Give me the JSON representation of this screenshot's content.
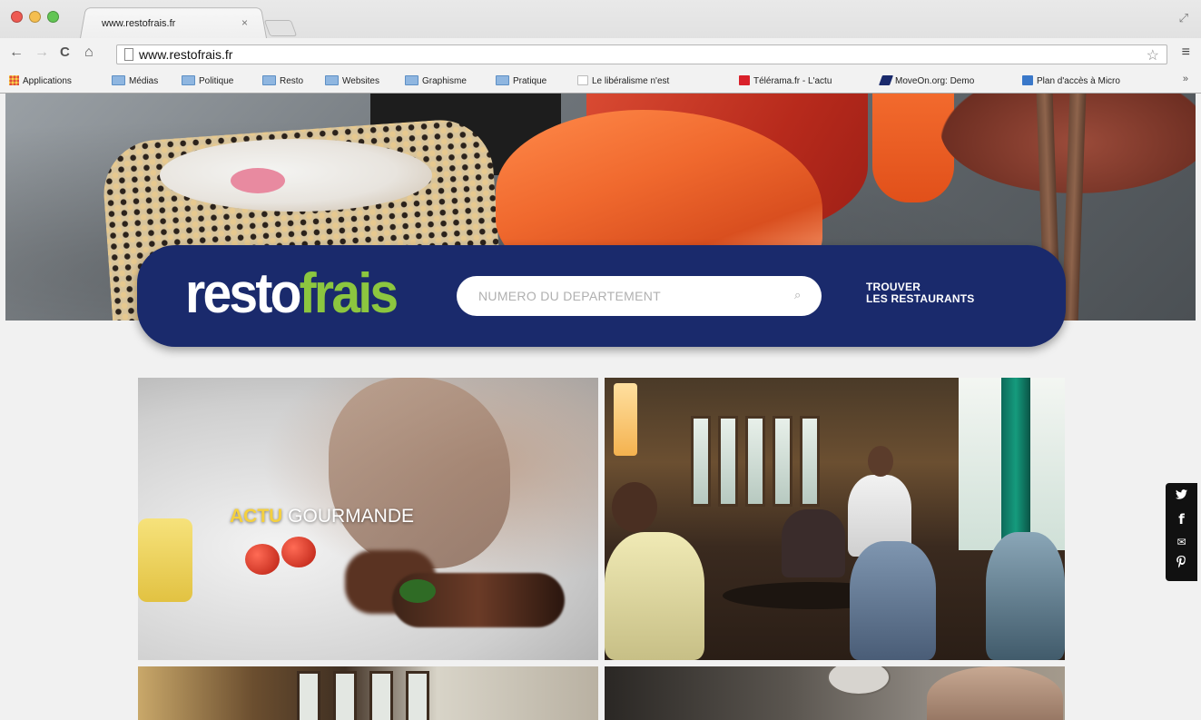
{
  "browser": {
    "tab_title": "www.restofrais.fr",
    "tab_close": "×",
    "url": "www.restofrais.fr",
    "icons": [
      "back-icon",
      "forward-icon",
      "reload-icon",
      "home-icon",
      "page-icon",
      "star-icon",
      "menu-icon",
      "fullscreen-icon"
    ],
    "nav_glyphs": {
      "back": "←",
      "forward": "→",
      "reload": "C",
      "home": "⌂",
      "star": "☆",
      "menu": "≡",
      "fullscreen": "⤢"
    }
  },
  "bookmarks": {
    "items": [
      {
        "label": "Applications",
        "icon": "apps-icon"
      },
      {
        "label": "Médias",
        "icon": "folder-icon"
      },
      {
        "label": "Politique",
        "icon": "folder-icon"
      },
      {
        "label": "Resto",
        "icon": "folder-icon"
      },
      {
        "label": "Websites",
        "icon": "folder-icon"
      },
      {
        "label": "Graphisme",
        "icon": "folder-icon"
      },
      {
        "label": "Pratique",
        "icon": "folder-icon"
      },
      {
        "label": "Le libéralisme n'est",
        "icon": "page-icon"
      },
      {
        "label": "Télérama.fr - L'actu",
        "icon": "telerama-icon",
        "color": "#d9202a"
      },
      {
        "label": "MoveOn.org: Demo",
        "icon": "moveon-icon",
        "color": "#1a2a6c"
      },
      {
        "label": "Plan d'accès à Micro",
        "icon": "plan-icon",
        "color": "#3a78c9"
      }
    ],
    "more": "»"
  },
  "site": {
    "logo_part1": "resto",
    "logo_part2": "frais",
    "search": {
      "placeholder": "NUMERO DU DEPARTEMENT",
      "value": ""
    },
    "search_icon_glyph": "⌕",
    "find_line1": "TROUVER",
    "find_line2": "LES RESTAURANTS",
    "tiles": [
      {
        "caption_highlight": "ACTU",
        "caption": " GOURMANDE"
      }
    ],
    "social_glyphs": {
      "twitter": "🐦",
      "facebook": "f",
      "email": "✉",
      "pinterest": "℗"
    }
  },
  "colors": {
    "brand_navy": "#1a2a6c",
    "brand_green": "#8cc63f",
    "highlight_yellow": "#f4d03f"
  }
}
